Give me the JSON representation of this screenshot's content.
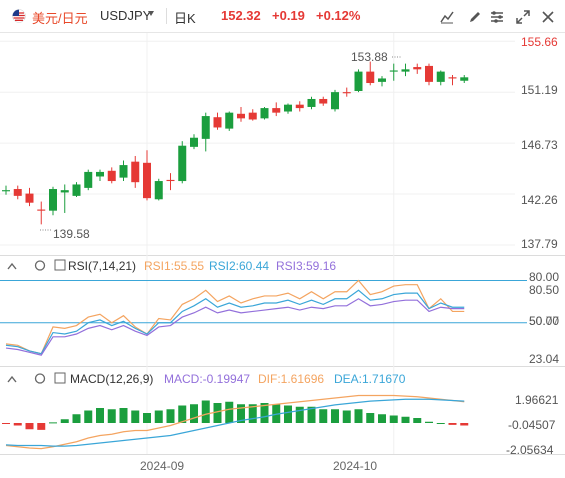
{
  "header": {
    "pair_cn": "美元/日元",
    "pair_code": "USDJPY",
    "timeframe": "日K",
    "price": "152.32",
    "change": "+0.19",
    "change_pct": "+0.12%",
    "up_color": "#e53935",
    "down_color": "#1b9e3e",
    "tools": [
      "line-chart-icon",
      "draw-icon",
      "settings-icon",
      "expand-icon",
      "close-icon"
    ]
  },
  "chart_data": [
    {
      "type": "candlestick",
      "title": "",
      "y_ticks": [
        "155.66",
        "151.19",
        "146.73",
        "142.26",
        "137.79"
      ],
      "ylim": [
        137.0,
        156.3
      ],
      "annotations": [
        {
          "text": "153.88",
          "kind": "high"
        },
        {
          "text": "139.58",
          "kind": "low"
        }
      ],
      "candles": [
        {
          "o": 142.5,
          "h": 143.0,
          "l": 142.2,
          "c": 142.6
        },
        {
          "o": 142.7,
          "h": 143.0,
          "l": 141.8,
          "c": 142.1
        },
        {
          "o": 142.3,
          "h": 142.8,
          "l": 141.2,
          "c": 141.5
        },
        {
          "o": 140.9,
          "h": 141.6,
          "l": 139.6,
          "c": 140.8
        },
        {
          "o": 140.8,
          "h": 142.9,
          "l": 140.4,
          "c": 142.7
        },
        {
          "o": 142.4,
          "h": 143.1,
          "l": 140.6,
          "c": 142.6
        },
        {
          "o": 142.1,
          "h": 143.3,
          "l": 142.0,
          "c": 143.1
        },
        {
          "o": 142.8,
          "h": 144.4,
          "l": 142.6,
          "c": 144.2
        },
        {
          "o": 143.8,
          "h": 144.4,
          "l": 143.4,
          "c": 144.2
        },
        {
          "o": 144.3,
          "h": 144.6,
          "l": 143.2,
          "c": 143.4
        },
        {
          "o": 143.7,
          "h": 145.2,
          "l": 143.4,
          "c": 144.8
        },
        {
          "o": 145.1,
          "h": 145.6,
          "l": 142.8,
          "c": 143.3
        },
        {
          "o": 145.0,
          "h": 146.1,
          "l": 141.7,
          "c": 141.9
        },
        {
          "o": 141.8,
          "h": 143.6,
          "l": 141.7,
          "c": 143.4
        },
        {
          "o": 143.5,
          "h": 144.1,
          "l": 142.6,
          "c": 143.4
        },
        {
          "o": 143.4,
          "h": 146.9,
          "l": 143.2,
          "c": 146.5
        },
        {
          "o": 146.4,
          "h": 147.5,
          "l": 146.2,
          "c": 147.2
        },
        {
          "o": 147.1,
          "h": 149.4,
          "l": 146.0,
          "c": 149.1
        },
        {
          "o": 149.0,
          "h": 149.4,
          "l": 147.9,
          "c": 148.1
        },
        {
          "o": 148.0,
          "h": 149.5,
          "l": 147.8,
          "c": 149.4
        },
        {
          "o": 149.3,
          "h": 149.9,
          "l": 148.6,
          "c": 148.9
        },
        {
          "o": 149.4,
          "h": 149.7,
          "l": 148.7,
          "c": 148.8
        },
        {
          "o": 148.9,
          "h": 149.9,
          "l": 148.8,
          "c": 149.8
        },
        {
          "o": 149.8,
          "h": 150.3,
          "l": 149.1,
          "c": 149.4
        },
        {
          "o": 149.5,
          "h": 150.2,
          "l": 149.3,
          "c": 150.1
        },
        {
          "o": 150.1,
          "h": 150.4,
          "l": 149.5,
          "c": 149.8
        },
        {
          "o": 149.9,
          "h": 150.8,
          "l": 149.7,
          "c": 150.6
        },
        {
          "o": 150.6,
          "h": 150.8,
          "l": 150.0,
          "c": 150.2
        },
        {
          "o": 149.7,
          "h": 151.4,
          "l": 149.5,
          "c": 151.2
        },
        {
          "o": 151.2,
          "h": 151.6,
          "l": 150.8,
          "c": 151.1
        },
        {
          "o": 151.3,
          "h": 153.2,
          "l": 151.2,
          "c": 153.0
        },
        {
          "o": 153.0,
          "h": 153.88,
          "l": 151.8,
          "c": 152.0
        },
        {
          "o": 152.1,
          "h": 152.6,
          "l": 151.7,
          "c": 152.4
        },
        {
          "o": 153.0,
          "h": 153.7,
          "l": 152.2,
          "c": 153.1
        },
        {
          "o": 153.0,
          "h": 153.7,
          "l": 152.6,
          "c": 153.2
        },
        {
          "o": 153.4,
          "h": 153.7,
          "l": 152.8,
          "c": 153.2
        },
        {
          "o": 153.5,
          "h": 153.7,
          "l": 151.8,
          "c": 152.1
        },
        {
          "o": 152.1,
          "h": 153.1,
          "l": 151.8,
          "c": 153.0
        },
        {
          "o": 152.5,
          "h": 152.7,
          "l": 151.8,
          "c": 152.4
        },
        {
          "o": 152.2,
          "h": 152.7,
          "l": 152.0,
          "c": 152.5
        }
      ]
    },
    {
      "type": "line",
      "indicator": "RSI",
      "legend_label": "RSI(7,14,21)",
      "legend": [
        {
          "name": "RSI1:55.55",
          "color": "#f4a460"
        },
        {
          "name": "RSI2:60.44",
          "color": "#3aa6d8"
        },
        {
          "name": "RSI3:59.16",
          "color": "#9370db"
        }
      ],
      "y_ticks": [
        "80.00",
        "80.50",
        "50.00",
        "50.77",
        "23.04"
      ],
      "hlines": [
        80,
        50
      ],
      "ylim": [
        20,
        86
      ],
      "series": [
        {
          "name": "RSI1",
          "color": "#f4a460",
          "values": [
            35,
            34,
            30,
            28,
            47,
            46,
            48,
            54,
            56,
            50,
            55,
            47,
            42,
            53,
            52,
            63,
            67,
            73,
            65,
            69,
            64,
            67,
            69,
            69,
            71,
            67,
            72,
            67,
            72,
            72,
            80,
            70,
            72,
            76,
            77,
            77,
            60,
            67,
            58,
            58
          ]
        },
        {
          "name": "RSI2",
          "color": "#3aa6d8",
          "values": [
            34,
            33,
            30,
            28,
            43,
            42,
            44,
            50,
            52,
            48,
            51,
            46,
            42,
            50,
            50,
            58,
            62,
            67,
            61,
            64,
            61,
            62,
            64,
            64,
            66,
            63,
            66,
            63,
            67,
            67,
            73,
            66,
            67,
            70,
            71,
            71,
            60,
            64,
            61,
            61
          ]
        },
        {
          "name": "RSI3",
          "color": "#9370db",
          "values": [
            32,
            31,
            29,
            27,
            40,
            40,
            42,
            46,
            48,
            45,
            48,
            44,
            41,
            47,
            48,
            54,
            57,
            61,
            57,
            59,
            57,
            58,
            59,
            60,
            61,
            59,
            61,
            60,
            62,
            62,
            67,
            62,
            63,
            65,
            66,
            66,
            58,
            61,
            60,
            60
          ]
        }
      ]
    },
    {
      "type": "bar",
      "indicator": "MACD",
      "legend_label": "MACD(12,26,9)",
      "legend": [
        {
          "name": "MACD:-0.19947",
          "color": "#9370db"
        },
        {
          "name": "DIF:1.61696",
          "color": "#f4a460"
        },
        {
          "name": "DEA:1.71670",
          "color": "#3aa6d8"
        }
      ],
      "y_ticks": [
        "1.96621",
        "-0.04507",
        "-2.05634"
      ],
      "ylim": [
        -2.4,
        2.8
      ],
      "histogram": [
        -0.05,
        -0.2,
        -0.5,
        -0.55,
        0.05,
        0.3,
        0.7,
        1.0,
        1.2,
        1.1,
        1.2,
        1.0,
        0.8,
        1.0,
        1.1,
        1.4,
        1.5,
        1.8,
        1.6,
        1.7,
        1.5,
        1.5,
        1.6,
        1.5,
        1.4,
        1.3,
        1.3,
        1.1,
        1.1,
        1.0,
        1.1,
        0.8,
        0.7,
        0.6,
        0.5,
        0.4,
        0.1,
        0.0,
        -0.15,
        -0.2
      ],
      "dif": [
        -1.8,
        -1.9,
        -2.0,
        -2.05,
        -1.9,
        -1.7,
        -1.5,
        -1.2,
        -1.0,
        -0.9,
        -0.7,
        -0.6,
        -0.6,
        -0.4,
        -0.2,
        0.1,
        0.4,
        0.7,
        0.9,
        1.1,
        1.2,
        1.3,
        1.4,
        1.5,
        1.6,
        1.7,
        1.8,
        1.9,
        2.0,
        2.1,
        2.2,
        2.2,
        2.2,
        2.2,
        2.15,
        2.1,
        2.0,
        1.9,
        1.8,
        1.7
      ],
      "dea": [
        -1.75,
        -1.8,
        -1.8,
        -1.8,
        -1.85,
        -1.85,
        -1.8,
        -1.7,
        -1.6,
        -1.5,
        -1.4,
        -1.3,
        -1.2,
        -1.1,
        -1.0,
        -0.8,
        -0.6,
        -0.4,
        -0.2,
        0.0,
        0.2,
        0.35,
        0.5,
        0.7,
        0.85,
        1.0,
        1.15,
        1.3,
        1.45,
        1.55,
        1.65,
        1.75,
        1.8,
        1.85,
        1.9,
        1.9,
        1.9,
        1.85,
        1.8,
        1.75
      ]
    }
  ],
  "x_axis": {
    "ticks": [
      {
        "label": "2024-09",
        "index": 12
      },
      {
        "label": "2024-10",
        "index": 33
      }
    ]
  },
  "panel_labels": {
    "rsi_icon": "settings-icon",
    "macd_icon": "settings-icon"
  }
}
